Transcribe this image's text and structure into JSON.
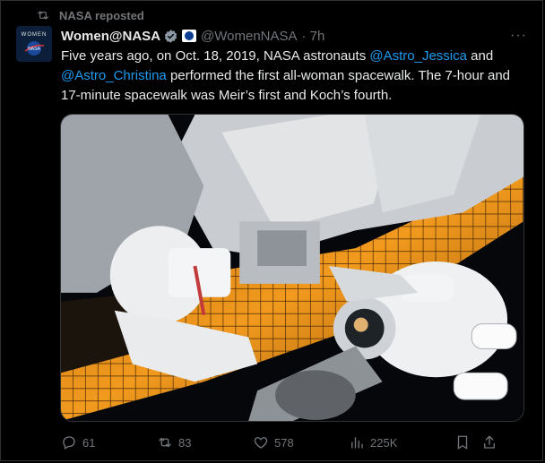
{
  "repost": {
    "text": "NASA reposted",
    "icon": "repost-icon"
  },
  "author": {
    "avatar_text": "WOMEN",
    "avatar_sub": "NASA",
    "name": "Women@NASA",
    "handle": "@WomenNASA",
    "time": "· 7h",
    "verified_color": "#1d9bf0"
  },
  "tweet": {
    "text_part1": "Five years ago, on Oct. 18, 2019, NASA astronauts ",
    "mention1": "@Astro_Jessica",
    "text_part2": " and ",
    "mention2": "@Astro_Christina",
    "text_part3": " performed the first all-woman spacewalk. The 7-hour and 17-minute spacewalk was Meir’s first and Koch’s fourth."
  },
  "actions": {
    "replies": "61",
    "reposts": "83",
    "likes": "578",
    "views": "225K"
  },
  "colors": {
    "accent": "#1d9bf0",
    "muted": "#71767b",
    "text": "#e7e9ea",
    "bg": "#000000"
  }
}
